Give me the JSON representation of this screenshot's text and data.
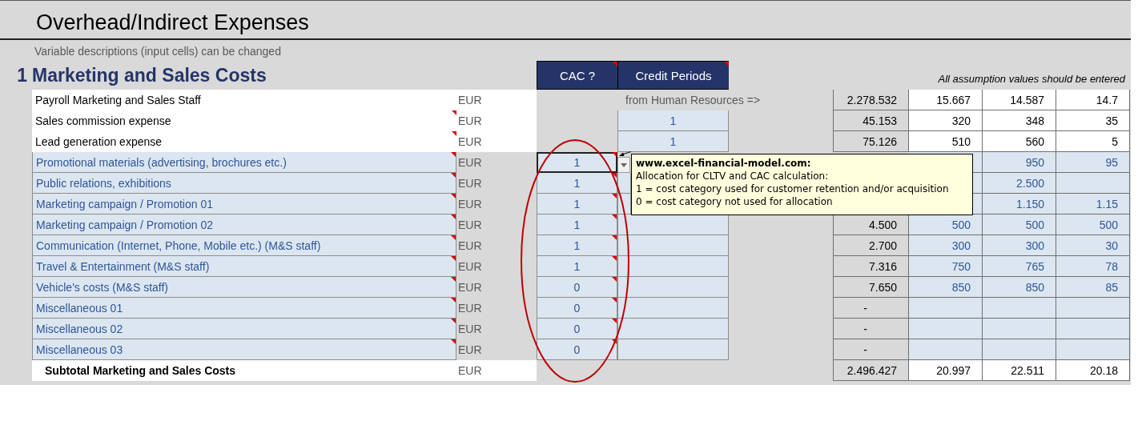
{
  "title": "Overhead/Indirect Expenses",
  "subtitle": "Variable descriptions (input cells) can be changed",
  "section": {
    "number": "1",
    "title": "Marketing and Sales Costs",
    "note": "All assumption values should be entered"
  },
  "column_buttons": [
    "CAC ?",
    "Credit Periods"
  ],
  "rows": [
    {
      "kind": "fixed",
      "label": "Payroll Marketing and Sales Staff",
      "comment": false,
      "unit": "EUR",
      "source_note": "from Human Resources =>",
      "total": "2.278.532",
      "values": [
        {
          "text": "15.667"
        },
        {
          "text": "14.587"
        },
        {
          "text": "14.7"
        }
      ]
    },
    {
      "kind": "fixed",
      "label": "Sales commission expense",
      "comment": true,
      "unit": "EUR",
      "credit": "1",
      "total": "45.153",
      "values": [
        {
          "text": "320"
        },
        {
          "text": "348"
        },
        {
          "text": "35"
        }
      ]
    },
    {
      "kind": "fixed",
      "label": "Lead generation expense",
      "comment": true,
      "unit": "EUR",
      "credit": "1",
      "total": "75.126",
      "values": [
        {
          "text": "510"
        },
        {
          "text": "560"
        },
        {
          "text": "5"
        }
      ]
    },
    {
      "kind": "input",
      "label": "Promotional materials (advertising, brochures etc.)",
      "comment": true,
      "unit": "EUR",
      "cac": "1",
      "selected": true,
      "values": [
        {
          "blank": true
        },
        {
          "text": "950"
        },
        {
          "text": "95"
        }
      ]
    },
    {
      "kind": "input",
      "label": "Public relations, exhibitions",
      "comment": true,
      "unit": "EUR",
      "cac": "1",
      "selected": false,
      "values": [
        {
          "blank": true
        },
        {
          "text": "2.500"
        },
        {
          "blank": true
        }
      ]
    },
    {
      "kind": "input",
      "label": "Marketing campaign / Promotion 01",
      "comment": true,
      "unit": "EUR",
      "cac": "1",
      "selected": false,
      "values": [
        {
          "blank": true
        },
        {
          "text": "1.150"
        },
        {
          "text": "1.15"
        }
      ]
    },
    {
      "kind": "input",
      "label": "Marketing campaign / Promotion 02",
      "comment": true,
      "unit": "EUR",
      "cac": "1",
      "selected": false,
      "total": "4.500",
      "values": [
        {
          "text": "500"
        },
        {
          "text": "500"
        },
        {
          "text": "500"
        }
      ]
    },
    {
      "kind": "input",
      "label": "Communication (Internet, Phone, Mobile etc.) (M&S staff)",
      "comment": true,
      "unit": "EUR",
      "cac": "1",
      "selected": false,
      "total": "2.700",
      "values": [
        {
          "text": "300"
        },
        {
          "text": "300"
        },
        {
          "text": "30"
        }
      ]
    },
    {
      "kind": "input",
      "label": "Travel & Entertainment (M&S staff)",
      "comment": true,
      "unit": "EUR",
      "cac": "1",
      "selected": false,
      "total": "7.316",
      "values": [
        {
          "text": "750"
        },
        {
          "text": "765"
        },
        {
          "text": "78"
        }
      ]
    },
    {
      "kind": "input",
      "label": "Vehicle's costs (M&S staff)",
      "comment": true,
      "unit": "EUR",
      "cac": "0",
      "selected": false,
      "total": "7.650",
      "values": [
        {
          "text": "850"
        },
        {
          "text": "850"
        },
        {
          "text": "85"
        }
      ]
    },
    {
      "kind": "input",
      "label": "Miscellaneous 01",
      "comment": true,
      "unit": "EUR",
      "cac": "0",
      "selected": false,
      "total": "-",
      "values": [
        {
          "blank": true
        },
        {
          "blank": true
        },
        {
          "blank": true
        }
      ]
    },
    {
      "kind": "input",
      "label": "Miscellaneous 02",
      "comment": true,
      "unit": "EUR",
      "cac": "0",
      "selected": false,
      "total": "-",
      "values": [
        {
          "blank": true
        },
        {
          "blank": true
        },
        {
          "blank": true
        }
      ]
    },
    {
      "kind": "input",
      "label": "Miscellaneous 03",
      "comment": true,
      "unit": "EUR",
      "cac": "0",
      "selected": false,
      "total": "-",
      "values": [
        {
          "blank": true
        },
        {
          "blank": true
        },
        {
          "blank": true
        }
      ]
    }
  ],
  "subtotal": {
    "label": "Subtotal Marketing and Sales Costs",
    "unit": "EUR",
    "total": "2.496.427",
    "values": [
      "20.997",
      "22.511",
      "20.18"
    ]
  },
  "comment_popup": {
    "source": "www.excel-financial-model.com:",
    "lines": [
      "Allocation for CLTV and CAC calculation:",
      "1 = cost category used for customer retention and/or acquisition",
      "0 = cost category not used for allocation"
    ]
  }
}
